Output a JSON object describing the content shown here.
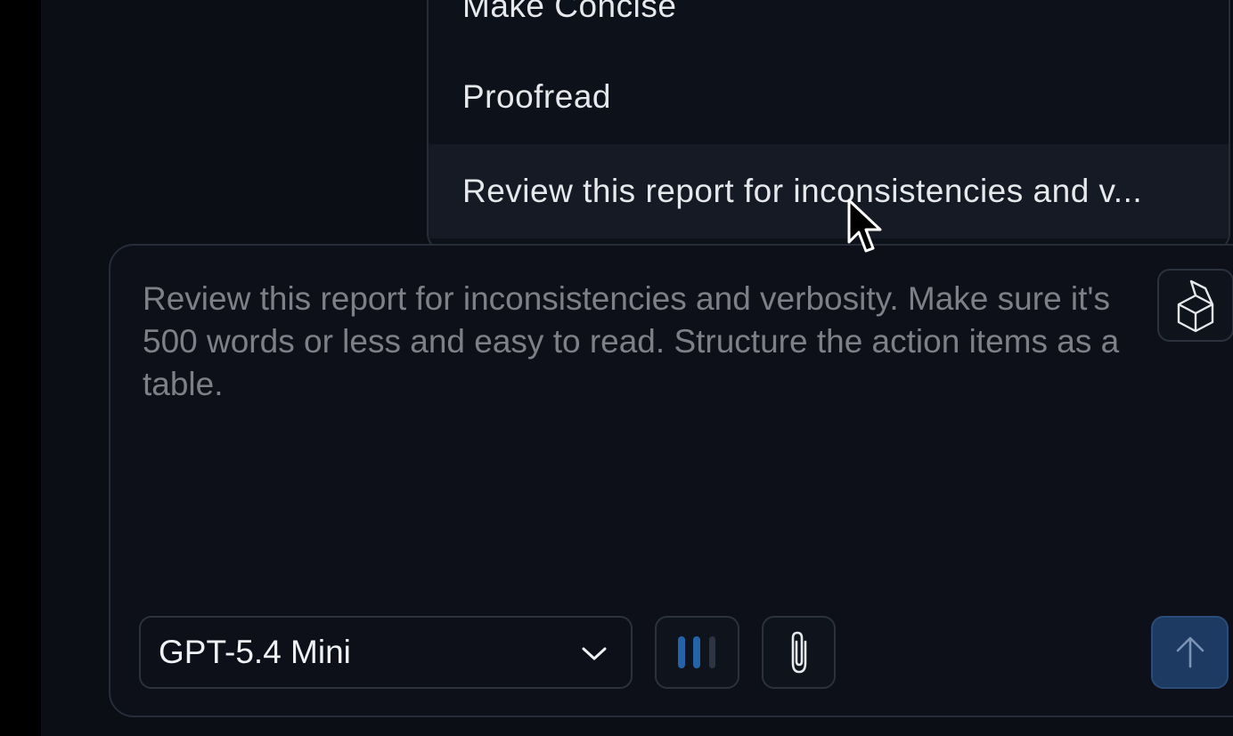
{
  "menu": {
    "items": [
      {
        "label": "Make Concise"
      },
      {
        "label": "Proofread"
      },
      {
        "label": "Review this report for inconsistencies and v..."
      }
    ]
  },
  "composer": {
    "placeholder": "Review this report for inconsistencies and verbosity. Make sure it's 500 words or less and easy to read. Structure the action items as a table.",
    "model": {
      "selected": "GPT-5.4 Mini"
    },
    "icons": {
      "cube": "cube-icon",
      "voice": "voice-bars-icon",
      "attach": "paperclip-icon",
      "send": "arrow-up-icon",
      "dropdown": "chevron-down-icon"
    }
  },
  "colors": {
    "background": "#0b0e15",
    "panel": "#0d1019",
    "border": "#262c38",
    "text": "#e6e8ec",
    "placeholder": "#7d8087",
    "accent": "#1c3a62",
    "voice_active": "#2563a8"
  }
}
